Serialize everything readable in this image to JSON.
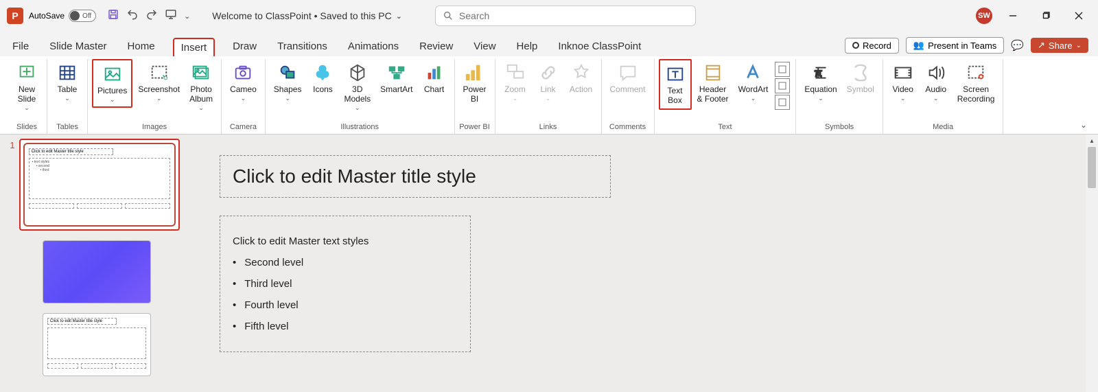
{
  "titlebar": {
    "autosave_label": "AutoSave",
    "autosave_state": "Off",
    "doc_title": "Welcome to ClassPoint • Saved to this PC",
    "search_placeholder": "Search",
    "user_initials": "SW"
  },
  "tabs": {
    "items": [
      "File",
      "Slide Master",
      "Home",
      "Insert",
      "Draw",
      "Transitions",
      "Animations",
      "Review",
      "View",
      "Help",
      "Inknoe ClassPoint"
    ],
    "active_index": 3,
    "record": "Record",
    "present": "Present in Teams",
    "share": "Share"
  },
  "ribbon": {
    "groups": [
      {
        "label": "Slides",
        "items": [
          {
            "name": "new-slide",
            "label": "New\nSlide",
            "caret": true
          }
        ]
      },
      {
        "label": "Tables",
        "items": [
          {
            "name": "table",
            "label": "Table",
            "caret": true
          }
        ]
      },
      {
        "label": "Images",
        "items": [
          {
            "name": "pictures",
            "label": "Pictures",
            "caret": true,
            "highlight": true
          },
          {
            "name": "screenshot",
            "label": "Screenshot",
            "caret": true
          },
          {
            "name": "photo-album",
            "label": "Photo\nAlbum",
            "caret": true
          }
        ]
      },
      {
        "label": "Camera",
        "items": [
          {
            "name": "cameo",
            "label": "Cameo",
            "caret": true
          }
        ]
      },
      {
        "label": "Illustrations",
        "items": [
          {
            "name": "shapes",
            "label": "Shapes",
            "caret": true
          },
          {
            "name": "icons",
            "label": "Icons"
          },
          {
            "name": "3d-models",
            "label": "3D\nModels",
            "caret": true
          },
          {
            "name": "smartart",
            "label": "SmartArt"
          },
          {
            "name": "chart",
            "label": "Chart"
          }
        ]
      },
      {
        "label": "Power BI",
        "items": [
          {
            "name": "power-bi",
            "label": "Power\nBI"
          }
        ]
      },
      {
        "label": "Links",
        "items": [
          {
            "name": "zoom",
            "label": "Zoom",
            "caret": true,
            "disabled": true
          },
          {
            "name": "link",
            "label": "Link",
            "caret": true,
            "disabled": true
          },
          {
            "name": "action",
            "label": "Action",
            "disabled": true
          }
        ]
      },
      {
        "label": "Comments",
        "items": [
          {
            "name": "comment",
            "label": "Comment",
            "disabled": true
          }
        ]
      },
      {
        "label": "Text",
        "items": [
          {
            "name": "text-box",
            "label": "Text\nBox",
            "highlight": true
          },
          {
            "name": "header-footer",
            "label": "Header\n& Footer"
          },
          {
            "name": "wordart",
            "label": "WordArt",
            "caret": true
          }
        ]
      },
      {
        "label": "Symbols",
        "items": [
          {
            "name": "equation",
            "label": "Equation",
            "caret": true
          },
          {
            "name": "symbol",
            "label": "Symbol",
            "disabled": true
          }
        ]
      },
      {
        "label": "Media",
        "items": [
          {
            "name": "video",
            "label": "Video",
            "caret": true
          },
          {
            "name": "audio",
            "label": "Audio",
            "caret": true
          },
          {
            "name": "screen-recording",
            "label": "Screen\nRecording"
          }
        ]
      }
    ]
  },
  "slide": {
    "number": "1",
    "title_placeholder": "Click to edit Master title style",
    "body_l1": "Click to edit Master text styles",
    "body_l2": "Second level",
    "body_l3": "Third level",
    "body_l4": "Fourth level",
    "body_l5": "Fifth level"
  }
}
